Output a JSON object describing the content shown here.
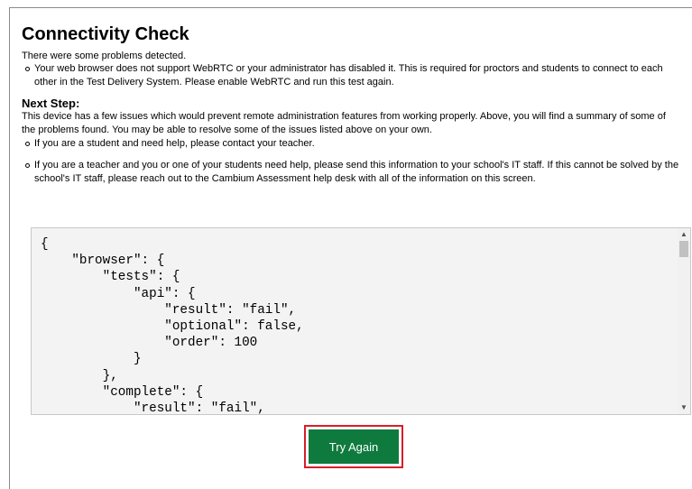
{
  "title": "Connectivity Check",
  "intro": "There were some problems detected.",
  "problems": [
    "Your web browser does not support WebRTC or your administrator has disabled it. This is required for proctors and students to connect to each other in the Test Delivery System. Please enable WebRTC and run this test again."
  ],
  "next_step": {
    "heading": "Next Step:",
    "text": "This device has a few issues which would prevent remote administration features from working properly. Above, you will find a summary of some of the problems found. You may be able to resolve some of the issues listed above on your own.",
    "items": [
      "If you are a student and need help, please contact your teacher.",
      "If you are a teacher and you or one of your students need help, please send this information to your school's IT staff. If this cannot be solved by the school's IT staff, please reach out to the Cambium Assessment help desk with all of the information on this screen."
    ]
  },
  "report_json": "{\n    \"browser\": {\n        \"tests\": {\n            \"api\": {\n                \"result\": \"fail\",\n                \"optional\": false,\n                \"order\": 100\n            }\n        },\n        \"complete\": {\n            \"result\": \"fail\",",
  "scroll_up_icon": "▲",
  "scroll_down_icon": "▼",
  "try_again_label": "Try Again",
  "colors": {
    "button": "#0f7a3e",
    "focus_ring": "#d81e2a",
    "code_background": "#f3f3f3"
  }
}
